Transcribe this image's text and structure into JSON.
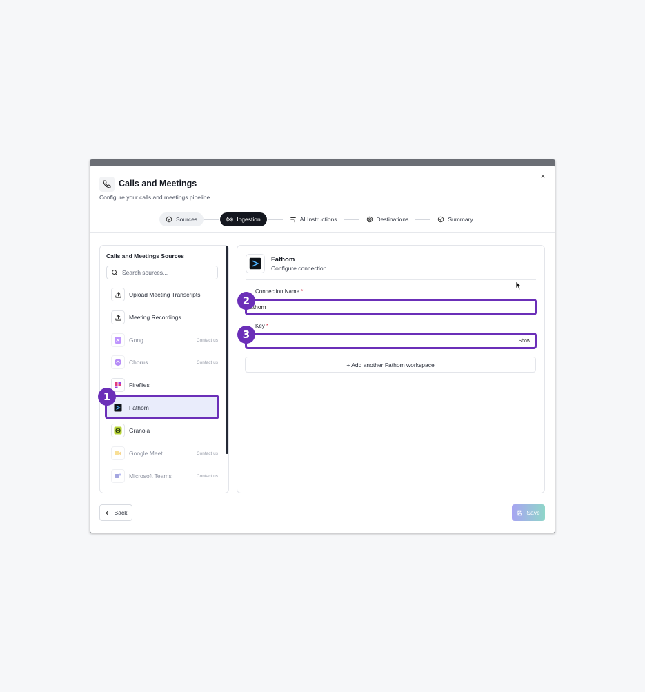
{
  "modal": {
    "title": "Calls and Meetings",
    "subtitle": "Configure your calls and meetings pipeline",
    "close_label": "×"
  },
  "steps": [
    {
      "label": "Sources",
      "state": "done",
      "icon": "check-circle-icon"
    },
    {
      "label": "Ingestion",
      "state": "active",
      "icon": "broadcast-icon"
    },
    {
      "label": "AI Instructions",
      "state": "pending",
      "icon": "text-icon"
    },
    {
      "label": "Destinations",
      "state": "pending",
      "icon": "target-icon"
    },
    {
      "label": "Summary",
      "state": "pending",
      "icon": "check-circle-icon"
    }
  ],
  "sources": {
    "title": "Calls and Meetings Sources",
    "search_placeholder": "Search sources...",
    "items": [
      {
        "label": "Upload Meeting Transcripts",
        "icon": "upload-icon",
        "contact": ""
      },
      {
        "label": "Meeting Recordings",
        "icon": "upload-icon",
        "contact": ""
      },
      {
        "label": "Gong",
        "icon": "gong-logo-icon",
        "contact": "Contact us"
      },
      {
        "label": "Chorus",
        "icon": "chorus-logo-icon",
        "contact": "Contact us"
      },
      {
        "label": "Fireflies",
        "icon": "fireflies-logo-icon",
        "contact": ""
      },
      {
        "label": "Fathom",
        "icon": "fathom-logo-icon",
        "contact": ""
      },
      {
        "label": "Granola",
        "icon": "granola-logo-icon",
        "contact": ""
      },
      {
        "label": "Google Meet",
        "icon": "google-meet-logo-icon",
        "contact": "Contact us"
      },
      {
        "label": "Microsoft Teams",
        "icon": "teams-logo-icon",
        "contact": "Contact us"
      }
    ]
  },
  "connection": {
    "name": "Fathom",
    "subtitle": "Configure connection",
    "name_label": "Connection Name",
    "name_value": "athom",
    "key_label": "Key",
    "key_value": "",
    "show_label": "Show",
    "required_mark": "*",
    "add_workspace": "+ Add another Fathom workspace"
  },
  "badges": [
    "1",
    "2",
    "3"
  ],
  "footer": {
    "back_label": "Back",
    "save_label": "Save"
  },
  "colors": {
    "accent": "#6b2fb8",
    "active_step": "#14171f",
    "selected_bg": "#e9ecfb"
  }
}
